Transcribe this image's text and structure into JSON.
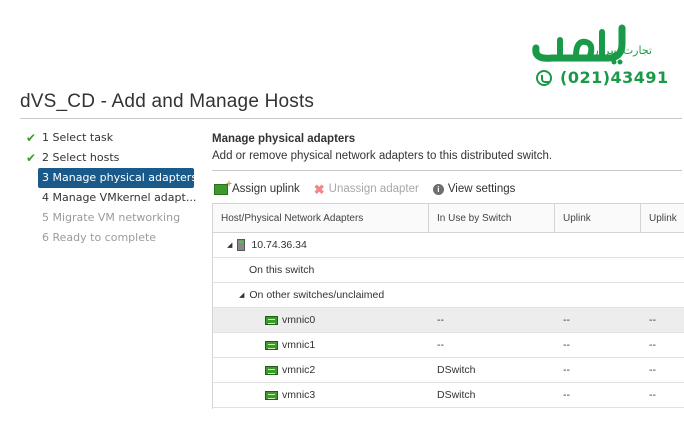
{
  "logo": {
    "tagline": "تجارت سرور"
  },
  "phone": {
    "number": "(021)43491"
  },
  "window": {
    "title": "dVS_CD - Add and Manage Hosts"
  },
  "steps": [
    {
      "label": "1 Select task",
      "state": "done"
    },
    {
      "label": "2 Select hosts",
      "state": "done"
    },
    {
      "label": "3 Manage physical adapters",
      "state": "active"
    },
    {
      "label": "4 Manage VMkernel adapt...",
      "state": "normal"
    },
    {
      "label": "5 Migrate VM networking",
      "state": "disabled"
    },
    {
      "label": "6 Ready to complete",
      "state": "disabled"
    }
  ],
  "pane": {
    "title": "Manage physical adapters",
    "description": "Add or remove physical network adapters to this distributed switch."
  },
  "toolbar": {
    "assign": "Assign uplink",
    "unassign": "Unassign adapter",
    "view": "View settings"
  },
  "table": {
    "columns": [
      "Host/Physical Network Adapters",
      "In Use by Switch",
      "Uplink",
      "Uplink"
    ],
    "host": "10.74.36.34",
    "group_on": "On this switch",
    "group_other": "On other switches/unclaimed",
    "rows": [
      {
        "name": "vmnic0",
        "switch": "--",
        "uplink": "--",
        "uplink2": "--"
      },
      {
        "name": "vmnic1",
        "switch": "--",
        "uplink": "--",
        "uplink2": "--"
      },
      {
        "name": "vmnic2",
        "switch": "DSwitch",
        "uplink": "--",
        "uplink2": "--"
      },
      {
        "name": "vmnic3",
        "switch": "DSwitch",
        "uplink": "--",
        "uplink2": "--"
      }
    ]
  },
  "colors": {
    "brand_green": "#1a9a48",
    "step_active": "#1a5a8a",
    "check": "#3c9a2c"
  }
}
